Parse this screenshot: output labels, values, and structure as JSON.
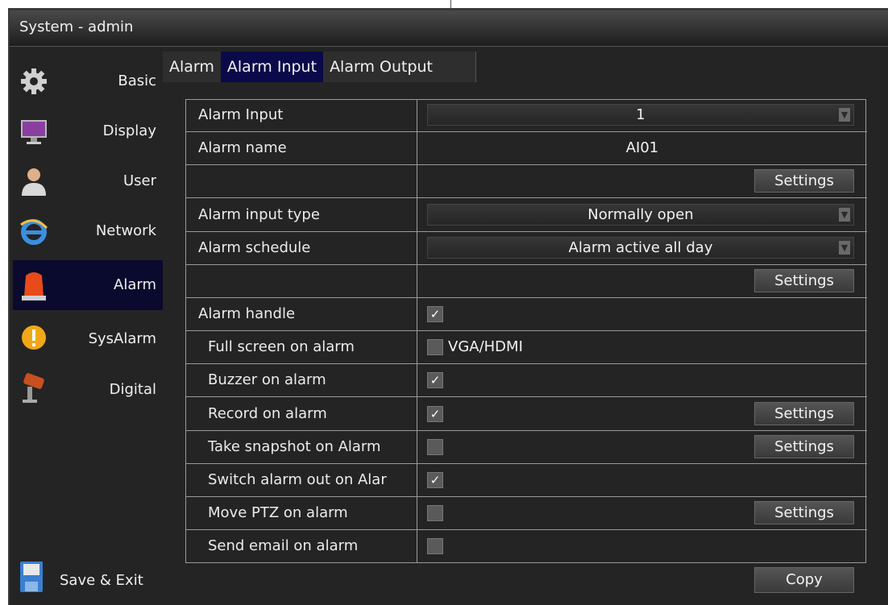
{
  "window": {
    "title": "System - admin"
  },
  "sidebar": {
    "items": [
      {
        "label": "Basic",
        "icon": "gear-icon"
      },
      {
        "label": "Display",
        "icon": "monitor-icon"
      },
      {
        "label": "User",
        "icon": "user-icon"
      },
      {
        "label": "Network",
        "icon": "network-icon"
      },
      {
        "label": "Alarm",
        "icon": "alarm-siren-icon",
        "active": true
      },
      {
        "label": "SysAlarm",
        "icon": "warning-icon"
      },
      {
        "label": "Digital",
        "icon": "camera-icon"
      }
    ],
    "save_exit": "Save & Exit"
  },
  "tabs": [
    {
      "label": "Alarm"
    },
    {
      "label": "Alarm Input",
      "active": true
    },
    {
      "label": "Alarm Output"
    }
  ],
  "form": {
    "alarm_input": {
      "label": "Alarm Input",
      "value": "1"
    },
    "alarm_name": {
      "label": "Alarm name",
      "value": "AI01"
    },
    "name_settings": "Settings",
    "input_type": {
      "label": "Alarm input type",
      "value": "Normally open"
    },
    "schedule": {
      "label": "Alarm schedule",
      "value": "Alarm active all day"
    },
    "schedule_settings": "Settings",
    "alarm_handle": {
      "label": "Alarm handle",
      "checked": true
    },
    "full_screen": {
      "label": "Full screen on alarm",
      "checked": false,
      "option": "VGA/HDMI"
    },
    "buzzer": {
      "label": "Buzzer on alarm",
      "checked": true
    },
    "record": {
      "label": "Record on alarm",
      "checked": true,
      "button": "Settings"
    },
    "snapshot": {
      "label": "Take snapshot on Alarm",
      "checked": false,
      "button": "Settings"
    },
    "switch_out": {
      "label": "Switch alarm out on Alar",
      "checked": true
    },
    "ptz": {
      "label": "Move PTZ on alarm",
      "checked": false,
      "button": "Settings"
    },
    "email": {
      "label": "Send email on alarm",
      "checked": false
    }
  },
  "copy_button": "Copy",
  "glyphs": {
    "check": "✓",
    "arrow": "▼"
  }
}
